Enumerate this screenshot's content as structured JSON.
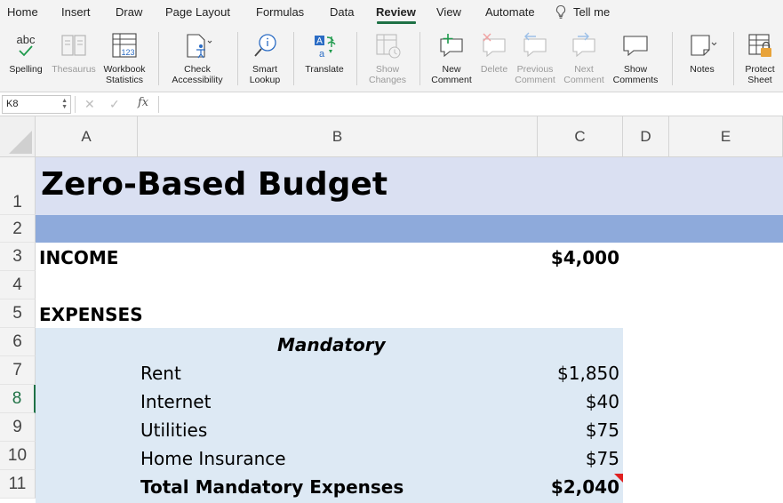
{
  "menu": {
    "tabs": [
      "Home",
      "Insert",
      "Draw",
      "Page Layout",
      "Formulas",
      "Data",
      "Review",
      "View",
      "Automate"
    ],
    "active_tab": "Review",
    "tell_me": "Tell me"
  },
  "ribbon": {
    "spelling": "Spelling",
    "thesaurus": "Thesaurus",
    "workbook_statistics": [
      "Workbook",
      "Statistics"
    ],
    "check_accessibility": [
      "Check",
      "Accessibility"
    ],
    "smart_lookup": [
      "Smart",
      "Lookup"
    ],
    "translate": "Translate",
    "show_changes": [
      "Show",
      "Changes"
    ],
    "new_comment": [
      "New",
      "Comment"
    ],
    "delete": "Delete",
    "previous_comment": [
      "Previous",
      "Comment"
    ],
    "next_comment": [
      "Next",
      "Comment"
    ],
    "show_comments": [
      "Show",
      "Comments"
    ],
    "notes": "Notes",
    "protect_sheet": [
      "Protect",
      "Sheet"
    ],
    "spelling_icon_text": "abc",
    "stats_icon_text": "123",
    "translate_icon_text": "a"
  },
  "formula_bar": {
    "name_box": "K8",
    "cancel_glyph": "✕",
    "enter_glyph": "✓",
    "fx_label": "fx",
    "formula": ""
  },
  "columns": [
    "A",
    "B",
    "C",
    "D",
    "E"
  ],
  "rows": [
    "1",
    "2",
    "3",
    "4",
    "5",
    "6",
    "7",
    "8",
    "9",
    "10",
    "11"
  ],
  "selected_row": "8",
  "sheet": {
    "title": "Zero-Based Budget",
    "income_label": "INCOME",
    "income_value": "$4,000",
    "expenses_label": "EXPENSES",
    "mandatory_header": "Mandatory",
    "items": [
      {
        "label": "Rent",
        "value": "$1,850"
      },
      {
        "label": "Internet",
        "value": "$40"
      },
      {
        "label": "Utilities",
        "value": "$75"
      },
      {
        "label": "Home Insurance",
        "value": "$75"
      }
    ],
    "total_label": "Total Mandatory Expenses",
    "total_value": "$2,040"
  },
  "colors": {
    "accent_green": "#1e7145",
    "title_band": "#dae0f2",
    "divider_band": "#8eaadb",
    "mandatory_band": "#dde9f4",
    "comment_marker": "#e02020"
  },
  "icons": [
    "lightbulb-icon",
    "spelling-icon",
    "thesaurus-icon",
    "workbook-statistics-icon",
    "check-accessibility-icon",
    "smart-lookup-icon",
    "translate-icon",
    "show-changes-icon",
    "new-comment-icon",
    "delete-comment-icon",
    "previous-comment-icon",
    "next-comment-icon",
    "show-comments-icon",
    "notes-icon",
    "protect-sheet-icon"
  ]
}
